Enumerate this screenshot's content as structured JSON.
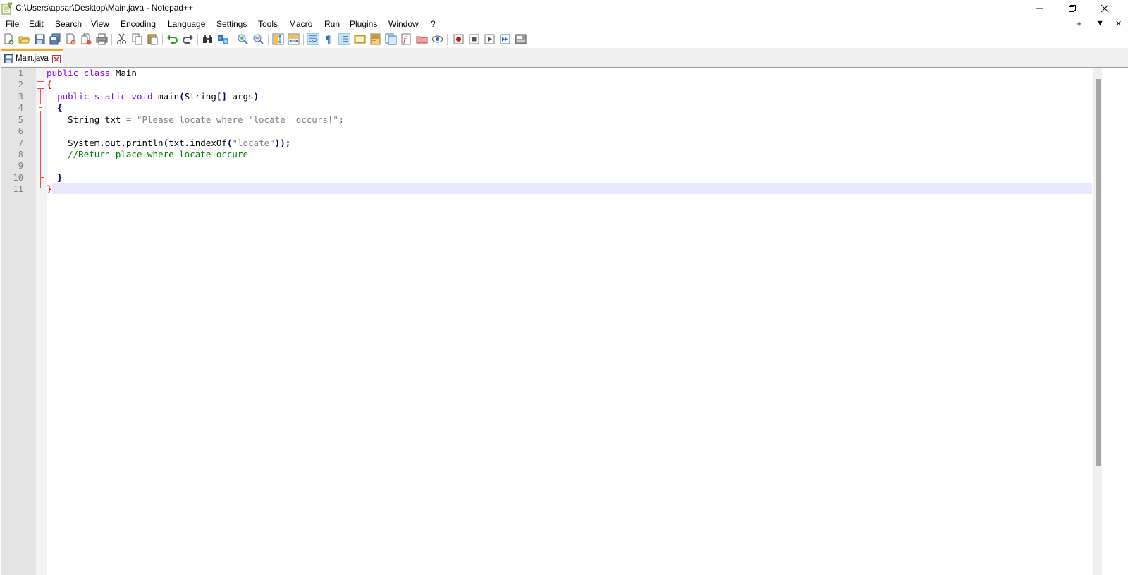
{
  "window": {
    "title": "C:\\Users\\apsar\\Desktop\\Main.java - Notepad++"
  },
  "menu": {
    "items": [
      "File",
      "Edit",
      "Search",
      "View",
      "Encoding",
      "Language",
      "Settings",
      "Tools",
      "Macro",
      "Run",
      "Plugins",
      "Window",
      "?"
    ],
    "right": {
      "add": "+",
      "down": "▼",
      "close": "✕"
    }
  },
  "tabs": [
    {
      "label": "Main.java",
      "active": true
    }
  ],
  "editor": {
    "line_numbers": [
      "1",
      "2",
      "3",
      "4",
      "5",
      "6",
      "7",
      "8",
      "9",
      "10",
      "11"
    ],
    "lines": {
      "l1": {
        "kw": "public class",
        "id": " Main"
      },
      "l2": {
        "brace": "{"
      },
      "l3": {
        "indent": "  ",
        "kw": "public static void",
        "id": " main",
        "p1": "(",
        "id2": "String",
        "p2": "[]",
        "id3": " args",
        "p3": ")"
      },
      "l4": {
        "indent": "  ",
        "brace": "{"
      },
      "l5": {
        "indent": "    ",
        "id": "String txt ",
        "op": "=",
        "str": " \"Please locate where 'locate' occurs!\"",
        "p": ";"
      },
      "l7": {
        "indent": "    ",
        "id": "System",
        "d1": ".",
        "id2": "out",
        "d2": ".",
        "id3": "println",
        "p1": "(",
        "id4": "txt",
        "d3": ".",
        "id5": "indexOf",
        "p2": "(",
        "str": "\"locate\"",
        "p3": "));"
      },
      "l8": {
        "indent": "    ",
        "cmt": "//Return place where locate occure"
      },
      "l10": {
        "indent": "  ",
        "brace": "}"
      },
      "l11": {
        "brace": "}"
      }
    },
    "current_line": 11
  },
  "colors": {
    "keyword": "#8000ff",
    "string": "#808080",
    "comment": "#008000",
    "operator": "#000080",
    "caret_line": "#e8e8ff",
    "tab_accent": "#f5a623"
  }
}
